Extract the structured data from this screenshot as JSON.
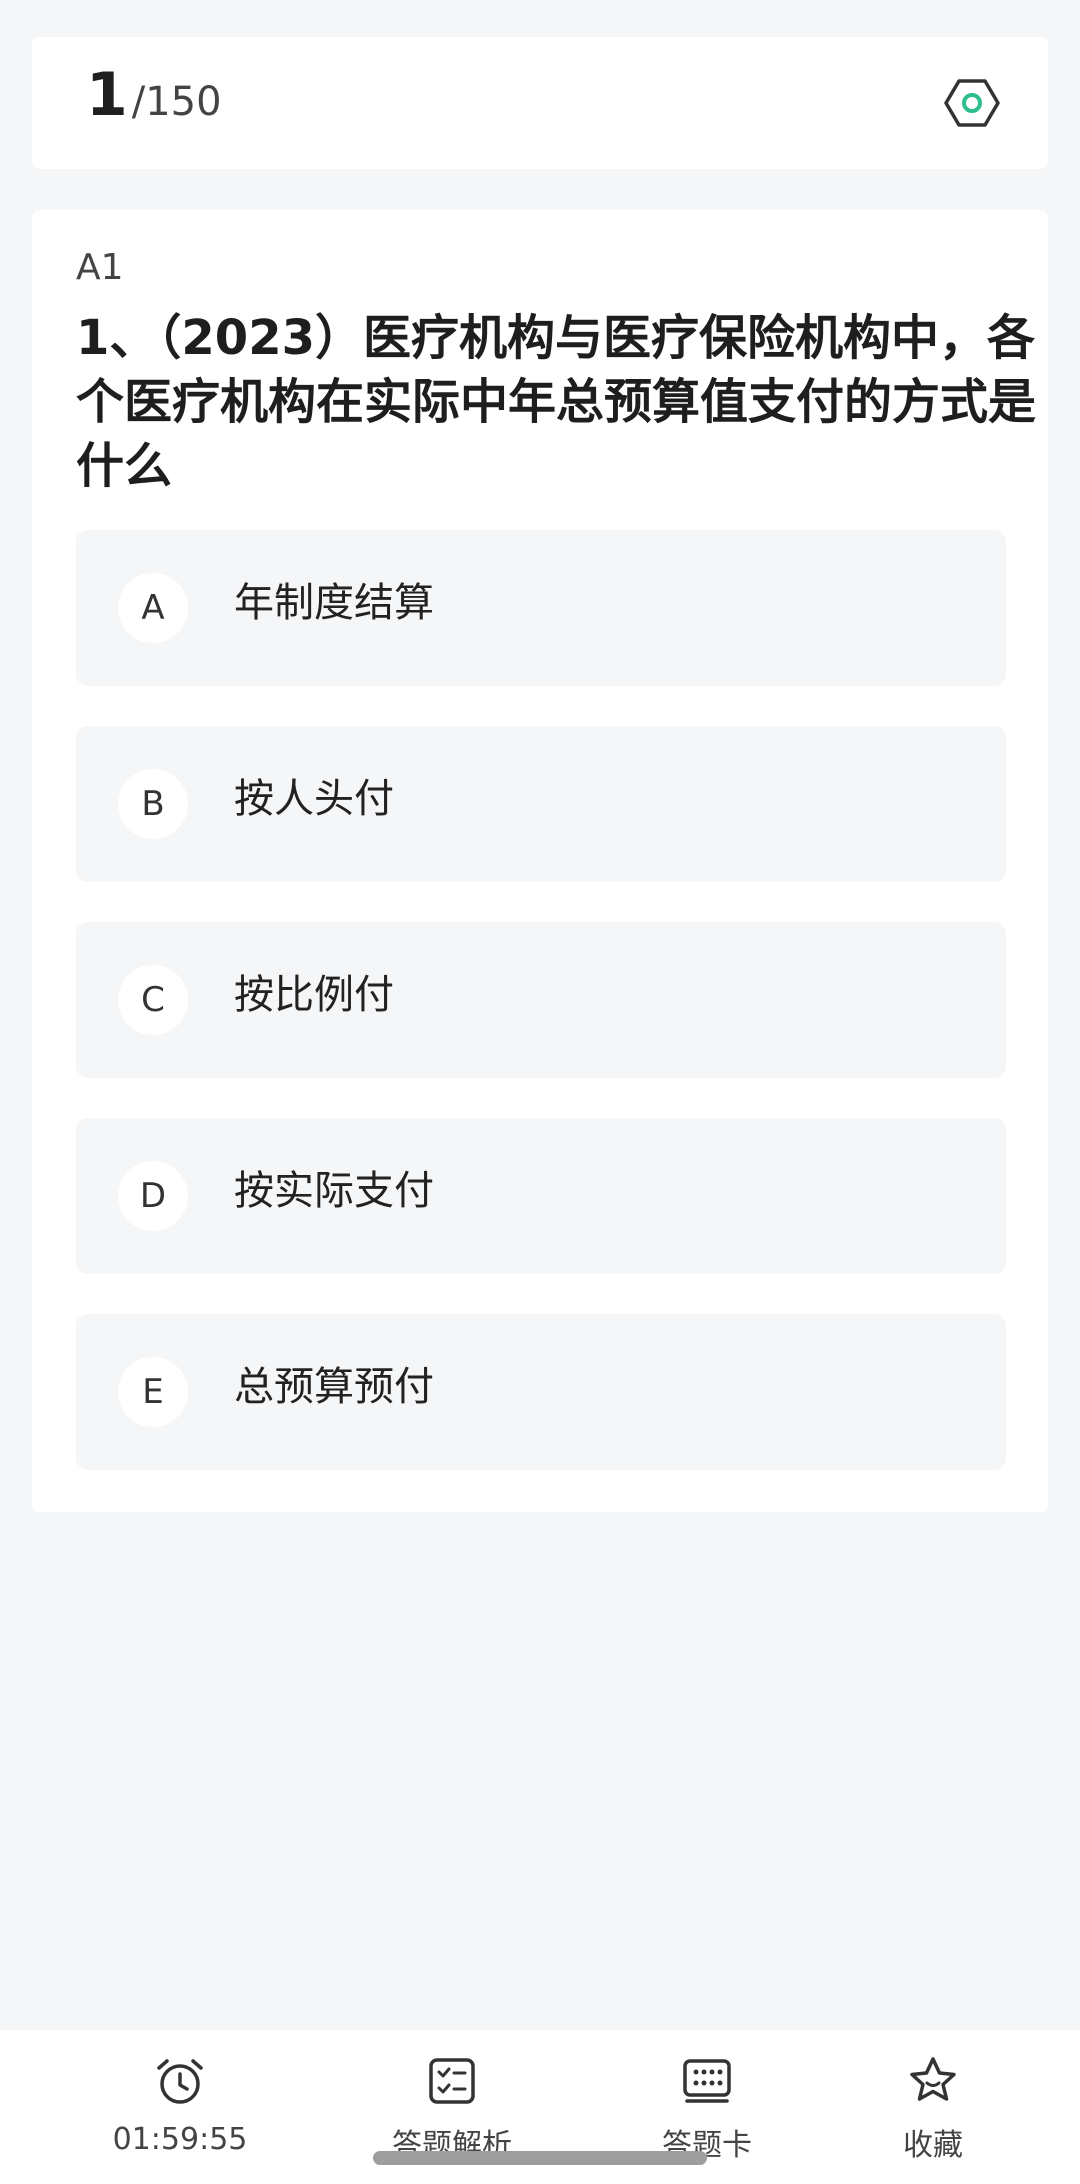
{
  "header": {
    "current": "1",
    "total": "/150",
    "settings_icon": "hexagon-settings-icon",
    "accent": "#2dbd8e"
  },
  "question": {
    "type": "A1",
    "text": "1、（2023）医疗机构与医疗保险机构中，各个医疗机构在实际中年总预算值支付的方式是什么",
    "options": [
      {
        "letter": "A",
        "text": "年制度结算"
      },
      {
        "letter": "B",
        "text": "按人头付"
      },
      {
        "letter": "C",
        "text": "按比例付"
      },
      {
        "letter": "D",
        "text": "按实际支付"
      },
      {
        "letter": "E",
        "text": "总预算预付"
      }
    ]
  },
  "bottom_bar": {
    "timer": {
      "icon": "alarm-clock-icon",
      "label": "01:59:55"
    },
    "analysis": {
      "icon": "checklist-icon",
      "label": "答题解析"
    },
    "answer_card": {
      "icon": "grid-card-icon",
      "label": "答题卡"
    },
    "favorite": {
      "icon": "star-icon",
      "label": "收藏"
    }
  }
}
